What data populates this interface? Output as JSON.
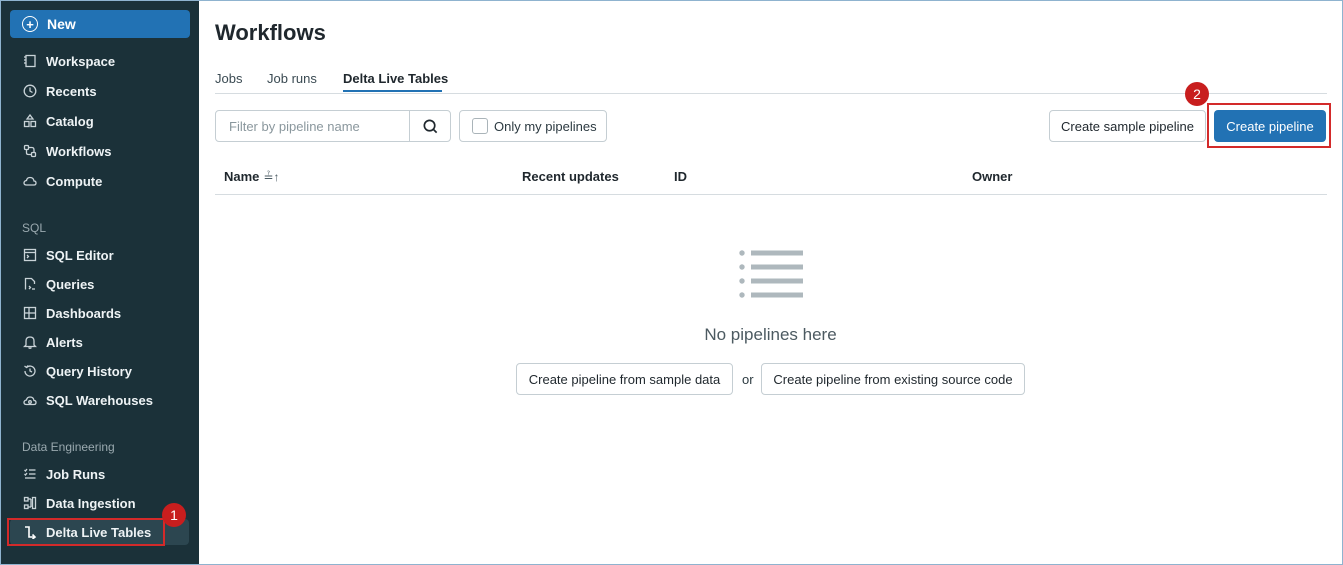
{
  "sidebar": {
    "new_label": "New",
    "items": [
      {
        "label": "Workspace",
        "icon": "workspace-icon"
      },
      {
        "label": "Recents",
        "icon": "clock-icon"
      },
      {
        "label": "Catalog",
        "icon": "catalog-icon"
      },
      {
        "label": "Workflows",
        "icon": "workflows-icon"
      },
      {
        "label": "Compute",
        "icon": "cloud-icon"
      }
    ],
    "sql_section": "SQL",
    "sql_items": [
      {
        "label": "SQL Editor",
        "icon": "sql-editor-icon"
      },
      {
        "label": "Queries",
        "icon": "queries-icon"
      },
      {
        "label": "Dashboards",
        "icon": "dashboards-icon"
      },
      {
        "label": "Alerts",
        "icon": "bell-icon"
      },
      {
        "label": "Query History",
        "icon": "history-icon"
      },
      {
        "label": "SQL Warehouses",
        "icon": "warehouse-icon"
      }
    ],
    "de_section": "Data Engineering",
    "de_items": [
      {
        "label": "Job Runs",
        "icon": "job-runs-icon"
      },
      {
        "label": "Data Ingestion",
        "icon": "ingestion-icon"
      },
      {
        "label": "Delta Live Tables",
        "icon": "dlt-icon",
        "active": true
      }
    ]
  },
  "main": {
    "title": "Workflows",
    "tabs": [
      {
        "label": "Jobs"
      },
      {
        "label": "Job runs"
      },
      {
        "label": "Delta Live Tables",
        "active": true
      }
    ],
    "search_placeholder": "Filter by pipeline name",
    "only_mine_label": "Only my pipelines",
    "create_sample_label": "Create sample pipeline",
    "create_label": "Create pipeline",
    "columns": [
      "Name",
      "Recent updates",
      "ID",
      "Owner"
    ],
    "empty_title": "No pipelines here",
    "from_sample_label": "Create pipeline from sample data",
    "or_label": "or",
    "from_source_label": "Create pipeline from existing source code"
  },
  "annotations": {
    "badge1": "1",
    "badge2": "2"
  },
  "colors": {
    "sidebar_bg": "#1b3139",
    "primary": "#2272b4",
    "highlight": "#d32a2a"
  }
}
